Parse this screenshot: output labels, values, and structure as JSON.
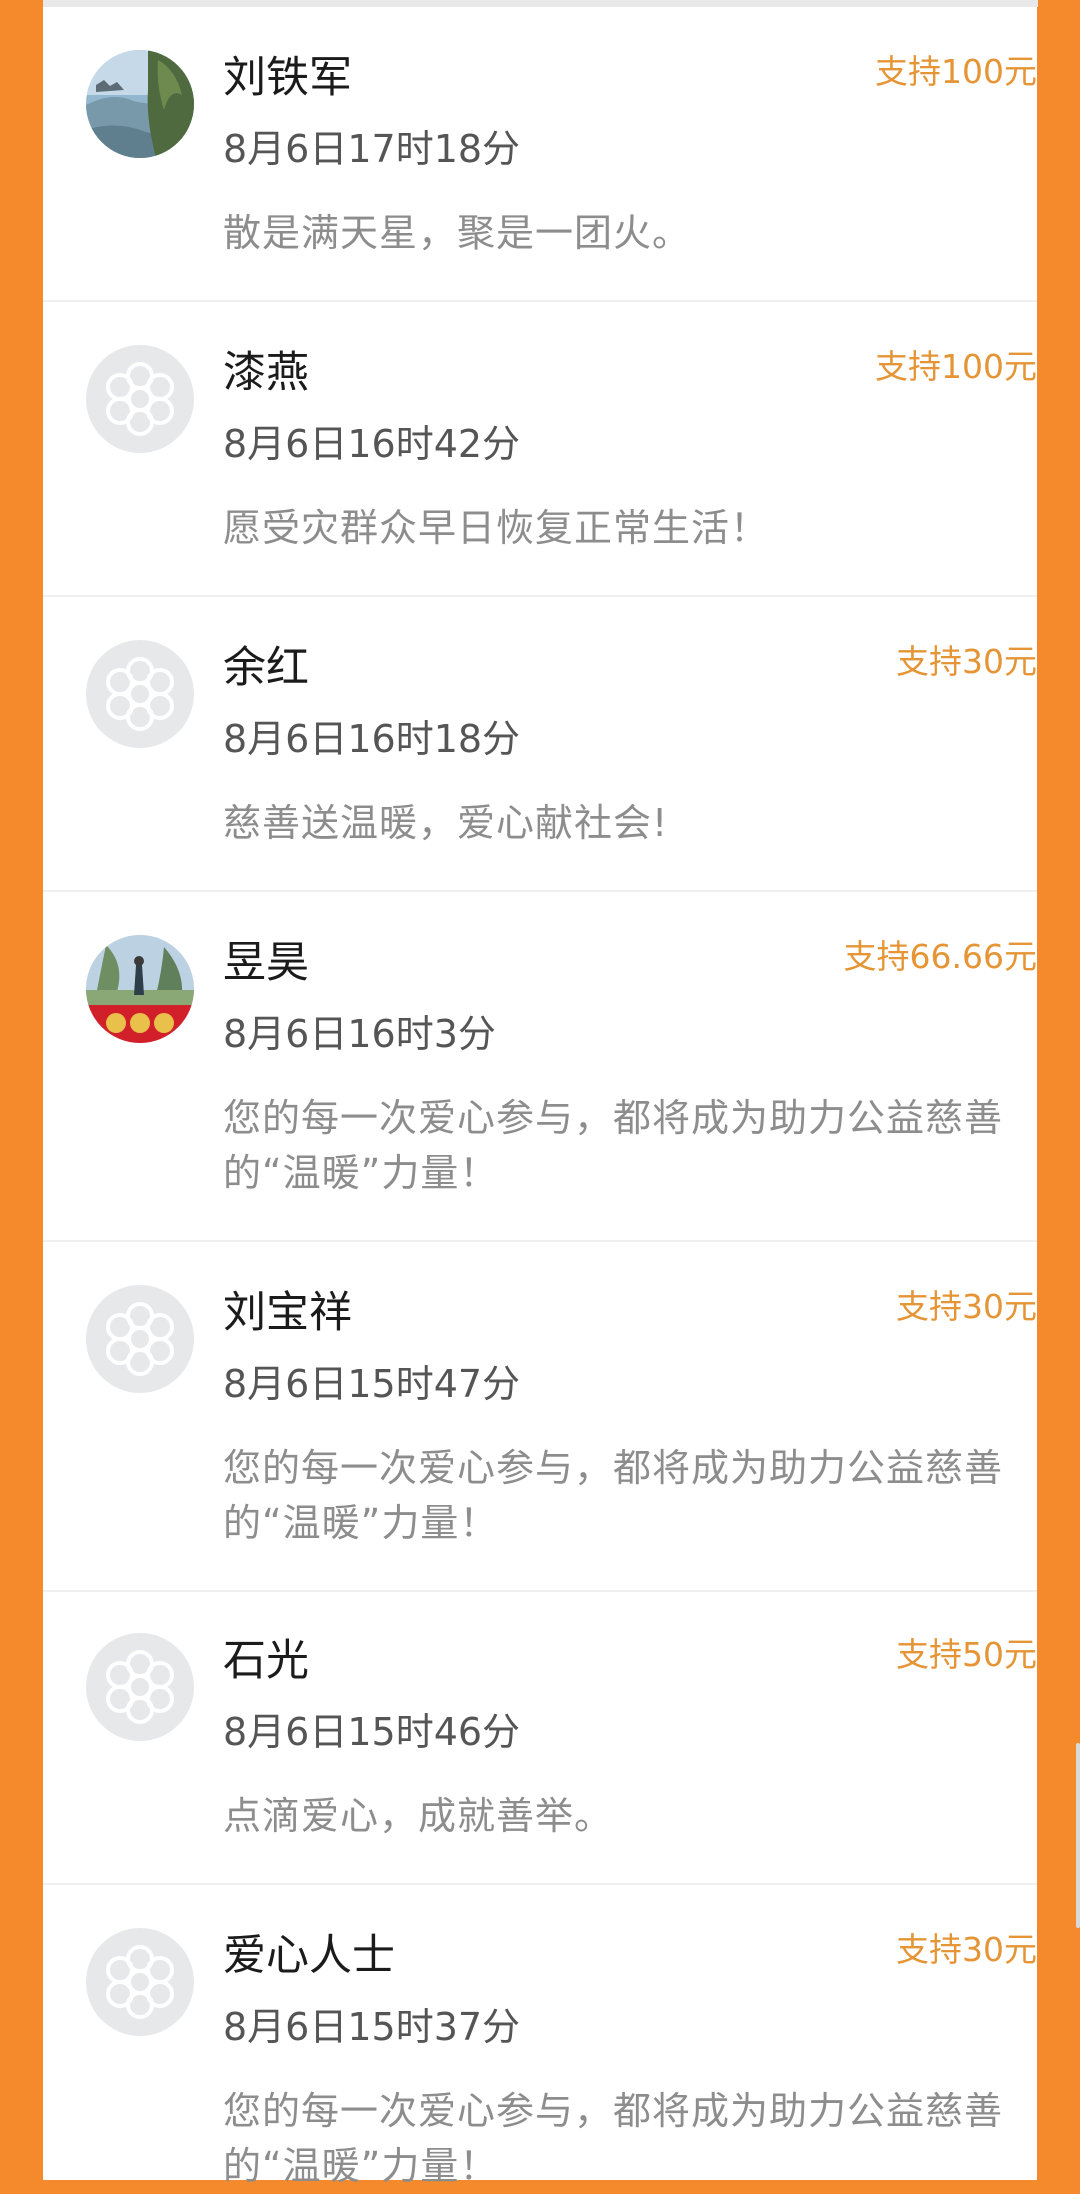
{
  "colors": {
    "background": "#f48a2c",
    "card": "#ffffff",
    "amount": "#e59535",
    "name": "#1b1b1b",
    "time": "#555555",
    "message": "#8d8d8d",
    "divider": "#efefef"
  },
  "supporters": [
    {
      "name": "刘铁军",
      "amount": "支持100元",
      "time": "8月6日17时18分",
      "message": "散是满天星，聚是一团火。",
      "avatar": "photo-lake-avatar"
    },
    {
      "name": "漆燕",
      "amount": "支持100元",
      "time": "8月6日16时42分",
      "message": "愿受灾群众早日恢复正常生活！",
      "avatar": "default-flower-avatar"
    },
    {
      "name": "余红",
      "amount": "支持30元",
      "time": "8月6日16时18分",
      "message": "慈善送温暖，爱心献社会!",
      "avatar": "default-flower-avatar"
    },
    {
      "name": "昱昊",
      "amount": "支持66.66元",
      "time": "8月6日16时3分",
      "message": "您的每一次爱心参与，都将成为助力公益慈善的“温暖”力量！",
      "avatar": "photo-red-banner-avatar"
    },
    {
      "name": "刘宝祥",
      "amount": "支持30元",
      "time": "8月6日15时47分",
      "message": "您的每一次爱心参与，都将成为助力公益慈善的“温暖”力量！",
      "avatar": "default-flower-avatar"
    },
    {
      "name": "石光",
      "amount": "支持50元",
      "time": "8月6日15时46分",
      "message": "点滴爱心，成就善举。",
      "avatar": "default-flower-avatar"
    },
    {
      "name": "爱心人士",
      "amount": "支持30元",
      "time": "8月6日15时37分",
      "message": "您的每一次爱心参与，都将成为助力公益慈善的“温暖”力量！",
      "avatar": "default-flower-avatar"
    }
  ]
}
